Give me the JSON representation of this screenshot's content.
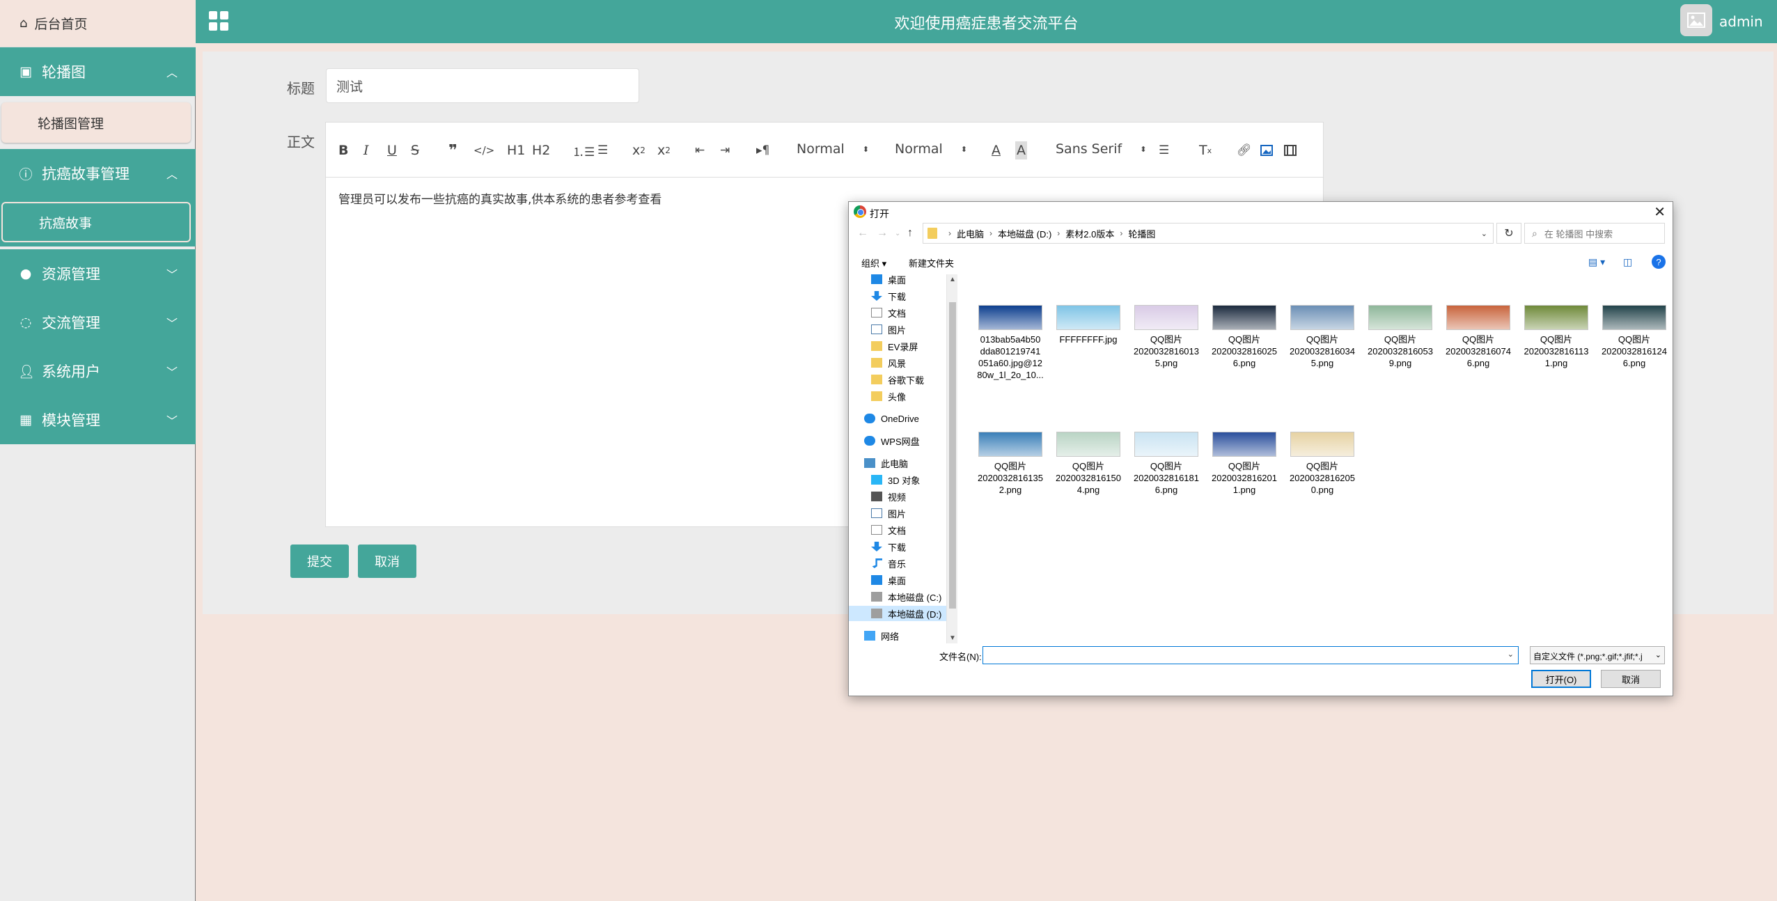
{
  "sidebar": {
    "home": "后台首页",
    "groups": [
      {
        "label": "轮播图",
        "sub": "轮播图管理"
      },
      {
        "label": "抗癌故事管理",
        "sub": "抗癌故事"
      },
      {
        "label": "资源管理"
      },
      {
        "label": "交流管理"
      },
      {
        "label": "系统用户"
      },
      {
        "label": "模块管理"
      }
    ]
  },
  "topbar": {
    "title": "欢迎使用癌症患者交流平台",
    "user": "admin"
  },
  "form": {
    "title_label": "标题",
    "title_value": "测试",
    "body_label": "正文",
    "body_text": "管理员可以发布一些抗癌的真实故事,供本系统的患者参考查看",
    "toolbar": {
      "size1": "Normal",
      "size2": "Normal",
      "font": "Sans Serif",
      "h1": "H1",
      "h2": "H2"
    },
    "submit": "提交",
    "cancel": "取消"
  },
  "dialog": {
    "title": "打开",
    "path": [
      "此电脑",
      "本地磁盘 (D:)",
      "素材2.0版本",
      "轮播图"
    ],
    "search_placeholder": "在 轮播图 中搜索",
    "organize": "组织 ▾",
    "new_folder": "新建文件夹",
    "nav": [
      {
        "label": "桌面",
        "icon": "desktop-icon",
        "pinned": true
      },
      {
        "label": "下载",
        "icon": "download-icon",
        "pinned": true
      },
      {
        "label": "文档",
        "icon": "document-icon",
        "pinned": true
      },
      {
        "label": "图片",
        "icon": "picture-icon",
        "pinned": true
      },
      {
        "label": "EV录屏",
        "icon": "folder-icon"
      },
      {
        "label": "风景",
        "icon": "folder-icon"
      },
      {
        "label": "谷歌下载",
        "icon": "folder-icon"
      },
      {
        "label": "头像",
        "icon": "folder-icon"
      },
      {
        "label": "OneDrive",
        "icon": "cloud-icon"
      },
      {
        "label": "WPS网盘",
        "icon": "cloud-icon"
      },
      {
        "label": "此电脑",
        "icon": "computer-icon"
      },
      {
        "label": "3D 对象",
        "icon": "cube-icon"
      },
      {
        "label": "视频",
        "icon": "video-icon"
      },
      {
        "label": "图片",
        "icon": "picture-icon"
      },
      {
        "label": "文档",
        "icon": "document-icon"
      },
      {
        "label": "下载",
        "icon": "download-icon"
      },
      {
        "label": "音乐",
        "icon": "music-icon"
      },
      {
        "label": "桌面",
        "icon": "desktop-icon"
      },
      {
        "label": "本地磁盘 (C:)",
        "icon": "drive-icon"
      },
      {
        "label": "本地磁盘 (D:)",
        "icon": "drive-icon",
        "selected": true
      },
      {
        "label": "网络",
        "icon": "network-icon"
      }
    ],
    "files": [
      {
        "lines": [
          "013bab5a4b50",
          "dda801219741",
          "051a60.jpg@12",
          "80w_1l_2o_10..."
        ],
        "color": "#0d3f8f"
      },
      {
        "lines": [
          "FFFFFFFF.jpg"
        ],
        "color": "#7fc4e6"
      },
      {
        "lines": [
          "QQ图片",
          "2020032816013",
          "5.png"
        ],
        "color": "#d9cbe6"
      },
      {
        "lines": [
          "QQ图片",
          "2020032816025",
          "6.png"
        ],
        "color": "#1b2a3e"
      },
      {
        "lines": [
          "QQ图片",
          "2020032816034",
          "5.png"
        ],
        "color": "#6b8fb5"
      },
      {
        "lines": [
          "QQ图片",
          "2020032816053",
          "9.png"
        ],
        "color": "#8fb79a"
      },
      {
        "lines": [
          "QQ图片",
          "2020032816074",
          "6.png"
        ],
        "color": "#c8643c"
      },
      {
        "lines": [
          "QQ图片",
          "2020032816113",
          "1.png"
        ],
        "color": "#6f8a3a"
      },
      {
        "lines": [
          "QQ图片",
          "2020032816124",
          "6.png"
        ],
        "color": "#22434a"
      },
      {
        "lines": [
          "QQ图片",
          "2020032816135",
          "2.png"
        ],
        "color": "#3a7fb8"
      },
      {
        "lines": [
          "QQ图片",
          "2020032816150",
          "4.png"
        ],
        "color": "#b9d4c4"
      },
      {
        "lines": [
          "QQ图片",
          "2020032816181",
          "6.png"
        ],
        "color": "#c9e3f2"
      },
      {
        "lines": [
          "QQ图片",
          "2020032816201",
          "1.png"
        ],
        "color": "#2a4f9c"
      },
      {
        "lines": [
          "QQ图片",
          "2020032816205",
          "0.png"
        ],
        "color": "#e6d2a3"
      }
    ],
    "filename_label": "文件名(N):",
    "filetype": "自定义文件 (*.png;*.gif;*.jfif;*.j",
    "open": "打开(O)",
    "cancel": "取消"
  },
  "colors": {
    "accent": "#44a69a",
    "background": "#f4e4dd"
  }
}
